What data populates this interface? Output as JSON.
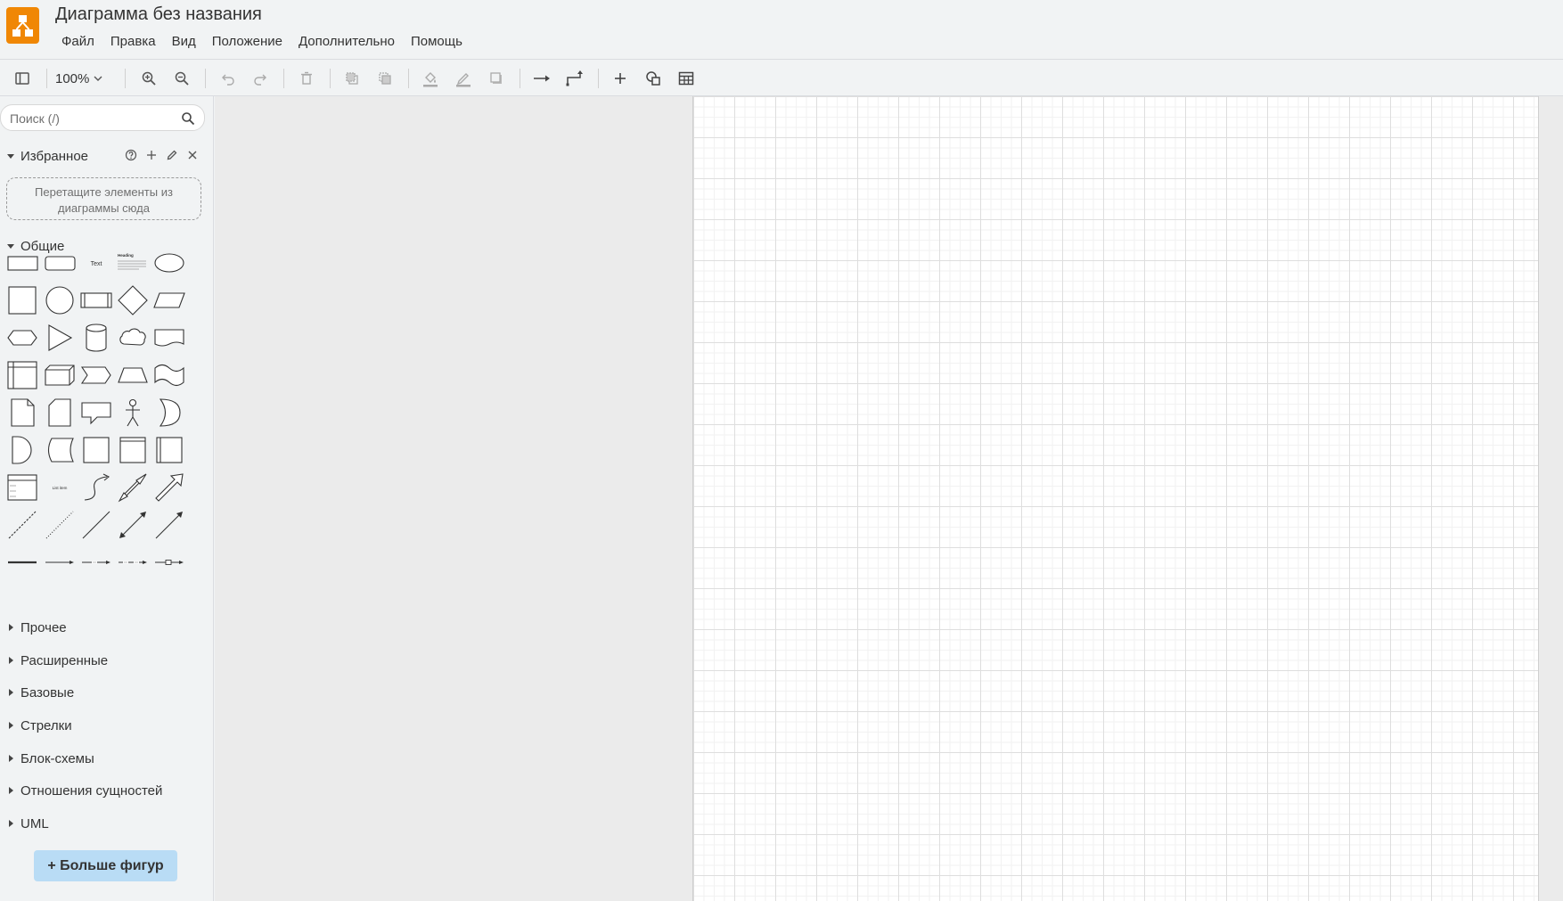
{
  "app": {
    "title": "Диаграмма без названия",
    "accent_color": "#f08705",
    "logo_icon": "drawio-logo-icon"
  },
  "menubar": {
    "items": [
      "Файл",
      "Правка",
      "Вид",
      "Положение",
      "Дополнительно",
      "Помощь"
    ]
  },
  "toolbar": {
    "zoom_label": "100%",
    "icons": [
      "sidebar-toggle-icon",
      "zoom-in-icon",
      "zoom-out-icon",
      "undo-icon",
      "redo-icon",
      "delete-icon",
      "to-front-icon",
      "to-back-icon",
      "fill-color-icon",
      "line-color-icon",
      "shadow-icon",
      "connection-icon",
      "waypoints-icon",
      "insert-icon",
      "shapes-icon",
      "table-icon"
    ]
  },
  "sidebar": {
    "search_placeholder": "Поиск (/)",
    "favorites": {
      "title": "Избранное",
      "dropzone_text": "Перетащите элементы из диаграммы сюда"
    },
    "general": {
      "title": "Общие",
      "shape_text_label": "Text",
      "shape_heading_label": "Heading",
      "shape_list_item_label": "List item"
    },
    "sections": [
      "Прочее",
      "Расширенные",
      "Базовые",
      "Стрелки",
      "Блок-схемы",
      "Отношения сущностей",
      "UML"
    ],
    "more_shapes_label": "+ Больше фигур",
    "more_shapes_color": "#b9dcf5"
  }
}
